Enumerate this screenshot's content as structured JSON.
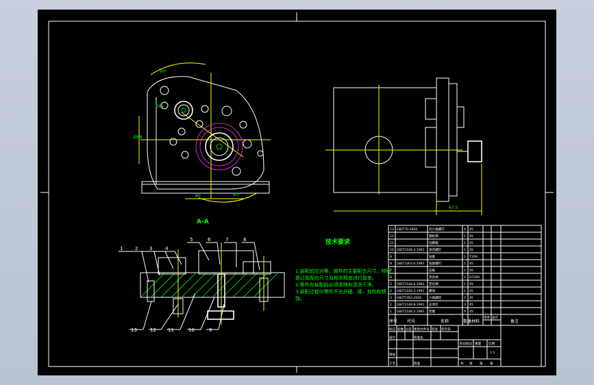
{
  "drawing": {
    "section_label": "A-A",
    "tech_title": "技术要求",
    "tech_notes": [
      "1.装配前应对零、部件的主要配合尺寸，特别",
      "是过盈配合尺寸及相关精度进行复查。",
      "2.零件在装配前必须清理和清洗干净，",
      "3.装配过程中零件不允许磕、碰、划伤和锈",
      "蚀。"
    ],
    "balloons": [
      "1",
      "2",
      "3",
      "4",
      "5",
      "6",
      "7",
      "8",
      "9",
      "10",
      "11",
      "12",
      "13"
    ],
    "dims": {
      "top_angle": "60°",
      "left_side": "R44",
      "left_height": "Ø88",
      "bottom_width": "80",
      "bottom_angle": "45°",
      "right_width": "67.5"
    },
    "bom_rows": [
      {
        "no": "13",
        "code": "GB/T70-2000",
        "name": "内六角螺钉",
        "qty": "4",
        "mat": "45"
      },
      {
        "no": "12",
        "code": "",
        "name": "圆柱销",
        "qty": "1",
        "mat": "45"
      },
      {
        "no": "11",
        "code": "",
        "name": "钻模板",
        "qty": "1",
        "mat": "45"
      },
      {
        "no": "10",
        "code": "GB/T2148.3-1991",
        "name": "滚花螺钉",
        "qty": "1",
        "mat": "45"
      },
      {
        "no": "9",
        "code": "",
        "name": "钻套",
        "qty": "1",
        "mat": "T10A"
      },
      {
        "no": "8",
        "code": "GB/T2263.6-1991",
        "name": "钻套螺钉",
        "qty": "1",
        "mat": "45"
      },
      {
        "no": "7",
        "code": "",
        "name": "压板",
        "qty": "1",
        "mat": "45"
      },
      {
        "no": "6",
        "code": "",
        "name": "夹具体",
        "qty": "1",
        "mat": "HT200"
      },
      {
        "no": "5",
        "code": "GB/T2148.6-1991",
        "name": "定位销",
        "qty": "1",
        "mat": "45"
      },
      {
        "no": "4",
        "code": "GB/T2148.2-1991",
        "name": "螺母",
        "qty": "1",
        "mat": "45"
      },
      {
        "no": "3",
        "code": "GB/T5783-2000",
        "name": "六角螺栓",
        "qty": "2",
        "mat": "45"
      },
      {
        "no": "2",
        "code": "GB/T2148.8-1991",
        "name": "支承钉",
        "qty": "3",
        "mat": "45"
      },
      {
        "no": "1",
        "code": "GB/T2148.5-1991",
        "name": "垫圈",
        "qty": "4",
        "mat": "45"
      }
    ],
    "bom_header": [
      "序号",
      "代号",
      "名称",
      "数量",
      "材料",
      "单件",
      "总计",
      "备注"
    ],
    "title_block": {
      "row1": [
        "标记",
        "处数",
        "分区",
        "更改文件号",
        "签名",
        "年月日"
      ],
      "row2": [
        "设计",
        "",
        "标准化"
      ],
      "row3": [
        "审核"
      ],
      "row4": [
        "工艺",
        "",
        "批准"
      ],
      "stage": [
        "阶段标记",
        "重量",
        "比例"
      ],
      "scale": "1:1",
      "sheet": [
        "共",
        "张",
        "第",
        "张"
      ]
    }
  }
}
